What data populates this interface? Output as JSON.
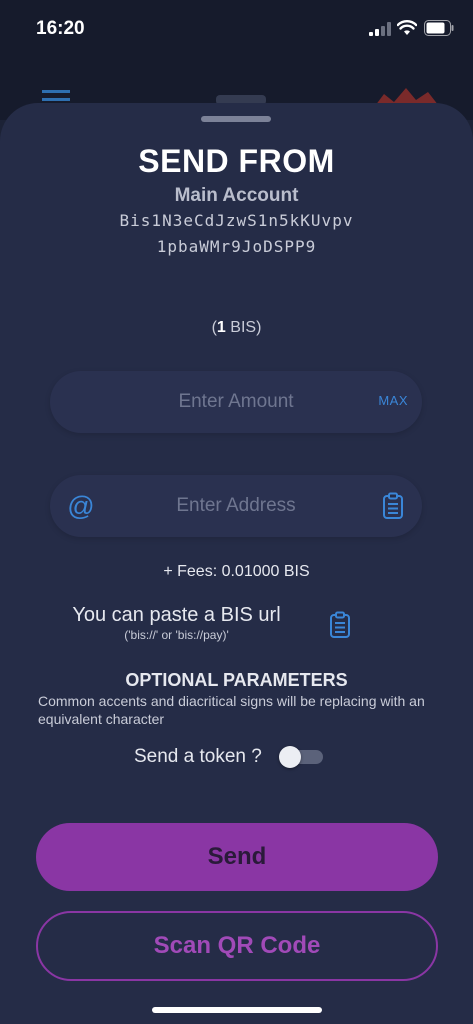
{
  "status_bar": {
    "time": "16:20"
  },
  "sheet": {
    "title": "SEND FROM",
    "account_name": "Main Account",
    "address_line1": "Bis1N3eCdJzwS1n5kKUvpv",
    "address_line2": "1pbaWMr9JoDSPP9",
    "balance_amount": "1",
    "balance_unit": "BIS",
    "amount_input": {
      "placeholder": "Enter Amount",
      "value": ""
    },
    "max_label": "MAX",
    "address_input": {
      "placeholder": "Enter Address",
      "value": ""
    },
    "fees": "+ Fees: 0.01000 BIS",
    "paste_title": "You can paste a BIS url",
    "paste_subtitle": "('bis://' or 'bis://pay)'",
    "optional_title": "OPTIONAL PARAMETERS",
    "optional_description": "Common accents and diacritical signs will be replacing with an equivalent character",
    "token_label": "Send a token ?",
    "token_enabled": false,
    "send_label": "Send",
    "scan_label": "Scan QR Code"
  },
  "colors": {
    "background": "#1c2236",
    "sheet": "#252c47",
    "accent_blue": "#3a86d8",
    "accent_purple": "#8a36a4"
  },
  "icons": [
    "signal-icon",
    "wifi-icon",
    "battery-icon",
    "menu-icon",
    "at-icon",
    "clipboard-icon"
  ]
}
